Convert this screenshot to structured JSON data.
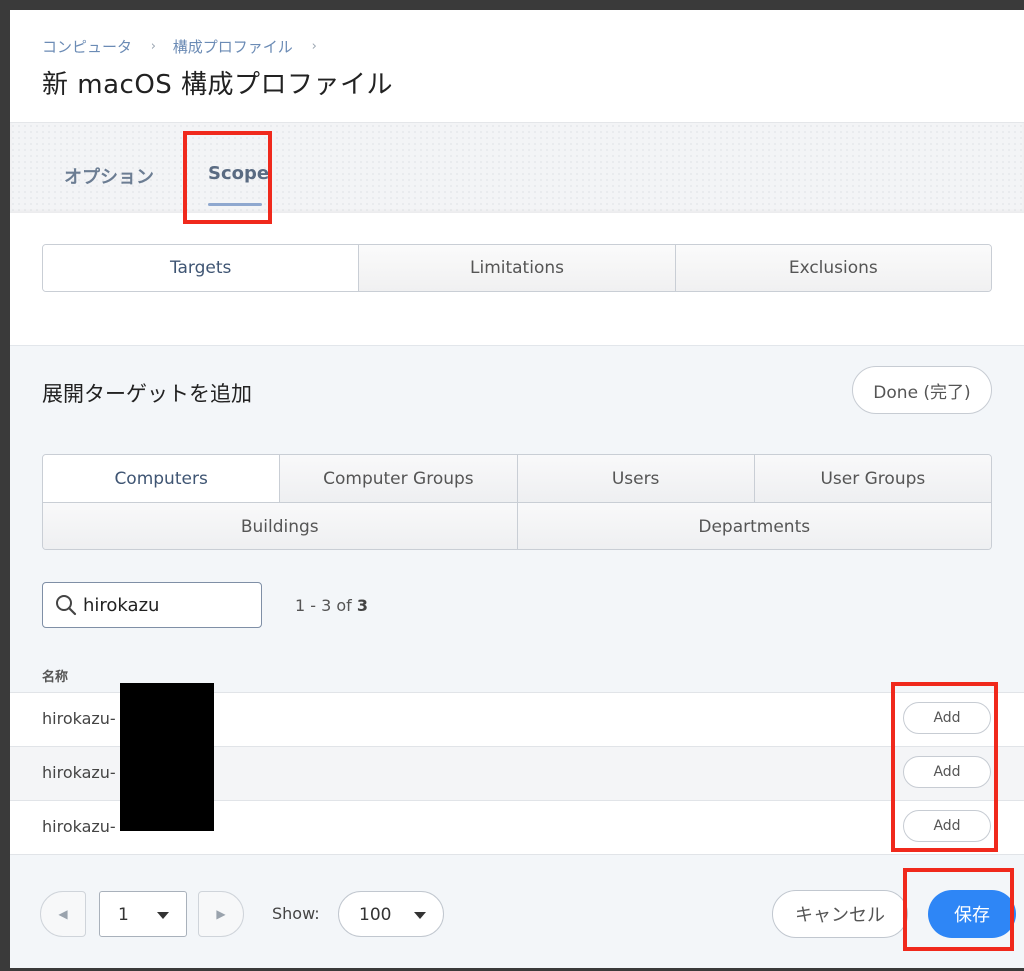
{
  "breadcrumb": {
    "items": [
      "コンピュータ",
      "構成プロファイル"
    ]
  },
  "page_title": "新 macOS 構成プロファイル",
  "tabs": {
    "options": "オプション",
    "scope": "Scope"
  },
  "scope_tabs": [
    "Targets",
    "Limitations",
    "Exclusions"
  ],
  "add_targets": {
    "title": "展開ターゲットを追加",
    "done_label": "Done (完了)",
    "target_types_row1": [
      "Computers",
      "Computer Groups",
      "Users",
      "User Groups"
    ],
    "target_types_row2": [
      "Buildings",
      "Departments"
    ],
    "active_type": "Computers"
  },
  "search": {
    "value": "hirokazu",
    "icon": "search-icon"
  },
  "results": {
    "range": "1 - 3 of ",
    "total": "3"
  },
  "table": {
    "column_name": "名称",
    "rows": [
      {
        "name": "hirokazu-",
        "action": "Add"
      },
      {
        "name": "hirokazu-",
        "action": "Add"
      },
      {
        "name": "hirokazu-",
        "action": "Add"
      }
    ]
  },
  "pagination": {
    "page": "1",
    "show_label": "Show:",
    "page_size": "100"
  },
  "footer": {
    "cancel_label": "キャンセル",
    "save_label": "保存"
  },
  "colors": {
    "accent": "#2e86f6",
    "highlight": "#f0291c"
  }
}
